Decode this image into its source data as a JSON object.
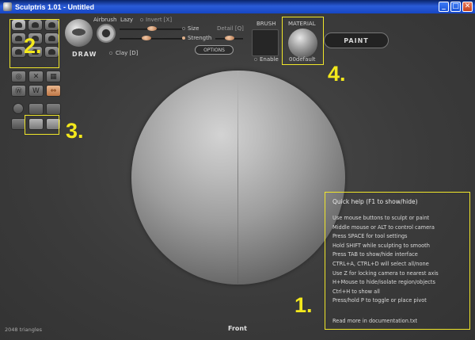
{
  "window": {
    "title": "Sculptris 1.01 - Untitled",
    "buttons": [
      "_",
      "□",
      "✕"
    ]
  },
  "top_panel": {
    "draw_label": "DRAW",
    "airbrush_label": "Airbrush",
    "lazy_label": "Lazy",
    "invert_label": "Invert [X]",
    "size_label": "Size",
    "strength_label": "Strength",
    "detail_label": "Detail [Q]",
    "options_label": "OPTIONS",
    "clay_label": "Clay [D]",
    "brush_label": "BRUSH",
    "enable_label": "Enable",
    "material_label": "MATERIAL",
    "material_name": "00default",
    "paint_label": "PAINT"
  },
  "callouts": {
    "one": "1.",
    "two": "2.",
    "three": "3.",
    "four": "4."
  },
  "tools": {
    "sculpt_tools": [
      "draw-tool",
      "inflate-tool",
      "pinch-tool",
      "flatten-tool",
      "crease-tool",
      "grab-tool",
      "rotate-tool",
      "scale-tool",
      "mask-tool"
    ],
    "symmetry_buttons": [
      "subdivide",
      "x-symmetry",
      "wireframe",
      "smooth",
      "reduce",
      "mirror"
    ],
    "symmetry_glyphs": [
      "◎",
      "✕",
      "▦",
      "Ⓦ",
      "W",
      "⇔"
    ]
  },
  "quick_help": {
    "title": "Quick help (F1 to show/hide)",
    "lines": [
      "Use mouse buttons to sculpt or paint",
      "Middle mouse or ALT to control camera",
      "Press SPACE for tool settings",
      "Hold SHIFT while sculpting to smooth",
      "Press TAB to show/hide interface",
      "CTRL+A, CTRL+D will select all/none",
      "Use Z for locking camera to nearest axis",
      "H+Mouse to hide/isolate region/objects",
      "Ctrl+H to show all",
      "Press/hold P to toggle or place pivot"
    ],
    "more": "Read more in documentation.txt"
  },
  "status": {
    "triangles": "2048 triangles",
    "view": "Front"
  },
  "colors": {
    "background": "#3a3a3a",
    "callout_yellow": "#f3e81c",
    "title_bar_blue": "#2a5bd7",
    "slider_knob": "#d69a6e"
  }
}
